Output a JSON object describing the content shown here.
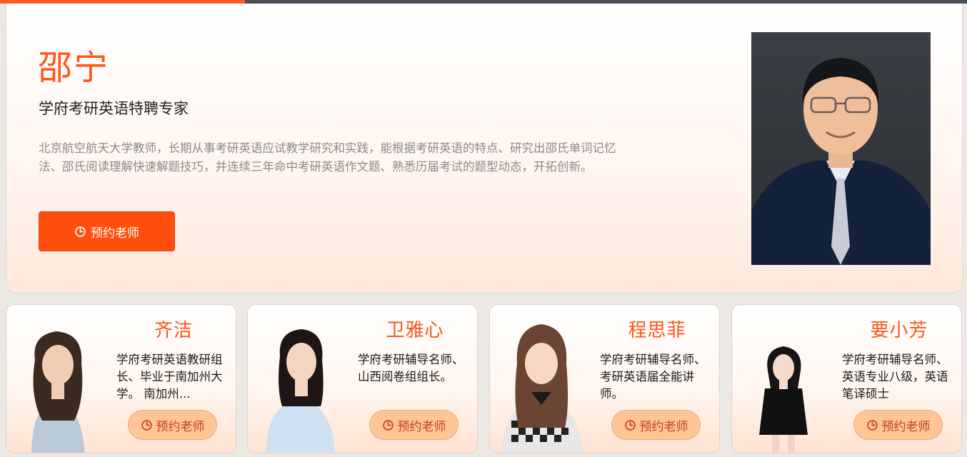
{
  "featured": {
    "name": "邵宁",
    "title": "学府考研英语特聘专家",
    "description": "北京航空航天大学教师，长期从事考研英语应试教学研究和实践，能根据考研英语的特点、研究出邵氏单词记忆法、邵氏阅读理解快速解题技巧，并连续三年命中考研英语作文题、熟悉历届考试的题型动态，开拓创新。",
    "button_label": "预约老师",
    "button_icon": "clock-icon"
  },
  "teachers": [
    {
      "name": "齐洁",
      "description": "学府考研英语教研组长、毕业于南加州大学。 南加州...",
      "button_label": "预约老师"
    },
    {
      "name": "卫雅心",
      "description": "学府考研辅导名师、山西阅卷组组长。",
      "button_label": "预约老师"
    },
    {
      "name": "程思菲",
      "description": "学府考研辅导名师、考研英语届全能讲师。",
      "button_label": "预约老师"
    },
    {
      "name": "要小芳",
      "description": "学府考研辅导名师、英语专业八级，英语笔译硕士",
      "button_label": "预约老师"
    }
  ],
  "colors": {
    "accent": "#ff5618",
    "button": "#ff4f0f",
    "card_button": "#ffc596"
  }
}
